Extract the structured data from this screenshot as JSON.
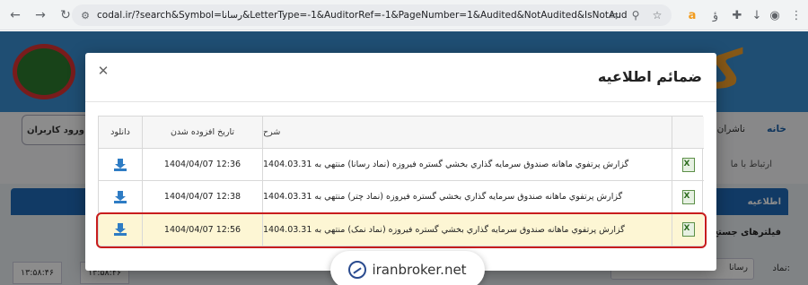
{
  "browser": {
    "url": "codal.ir/?search&Symbol=رسانا&LetterType=-1&AuditorRef=-1&PageNumber=1&Audited&NotAudited&IsNotAudited=false&C...",
    "colors": {
      "chrome_bg": "#f1f3f4",
      "omnibox_bg": "#e8eaed"
    }
  },
  "site": {
    "login_label": "ورود کاربران",
    "tabs": [
      "خانه",
      "ناشران"
    ],
    "sub_link": "ارتباط با ما",
    "section_label": "اطلاعیه",
    "filter_label": "فیلترهای جستج",
    "namad_label": "نماد:",
    "namad_value": "رسانا",
    "times": [
      "۱۳:۵۸:۴۶",
      "۱۳:۵۸:۴۶"
    ],
    "colors": {
      "banner": "#3a8fd1",
      "section_bar": "#1f6bb8"
    }
  },
  "modal": {
    "title": "ضمائم اطلاعيه",
    "close_symbol": "✕",
    "columns": {
      "desc": "شرح",
      "date": "تاريخ افزوده شدن",
      "download": "دانلود"
    },
    "rows": [
      {
        "desc": "گزارش پرتفوي ماهانه صندوق سرمايه گذاري بخشي گستره فيروزه (نماد رسانا) منتهي به 1404.03.31",
        "date": "1404/04/07 12:36",
        "highlighted": false
      },
      {
        "desc": "گزارش پرتفوي ماهانه صندوق سرمايه گذاري بخشي گستره فيروزه (نماد چتر) منتهي به 1404.03.31",
        "date": "1404/04/07 12:38",
        "highlighted": false
      },
      {
        "desc": "گزارش پرتفوي ماهانه صندوق سرمايه گذاري بخشي گستره فيروزه (نماد نمک) منتهي به 1404.03.31",
        "date": "1404/04/07 12:56",
        "highlighted": true
      }
    ],
    "colors": {
      "highlight_bg": "#fdf6d4",
      "highlight_border": "#c81d1d",
      "download_icon": "#2e7cc4"
    }
  },
  "watermark": {
    "text": "iranbroker.net"
  }
}
